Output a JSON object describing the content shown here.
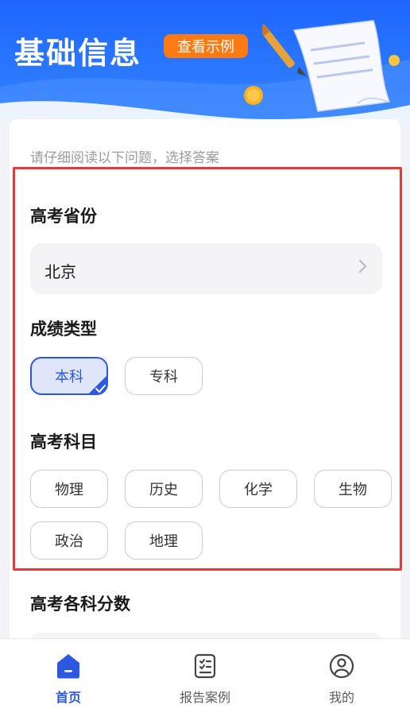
{
  "header": {
    "title": "基础信息",
    "example_button": "查看示例"
  },
  "hint": "请仔细阅读以下问题，选择答案",
  "province": {
    "label": "高考省份",
    "value": "北京"
  },
  "score_type": {
    "label": "成绩类型",
    "options": [
      "本科",
      "专科"
    ],
    "selected": "本科"
  },
  "subjects": {
    "label": "高考科目",
    "options": [
      "物理",
      "历史",
      "化学",
      "生物",
      "政治",
      "地理"
    ]
  },
  "scores": {
    "label": "高考各科分数"
  },
  "tabbar": {
    "items": [
      {
        "label": "首页",
        "icon": "home-icon",
        "active": true
      },
      {
        "label": "报告案例",
        "icon": "report-list-icon",
        "active": false
      },
      {
        "label": "我的",
        "icon": "profile-icon",
        "active": false
      }
    ]
  },
  "colors": {
    "primary": "#2c58e0",
    "header_blue": "#1e66ff",
    "accent_orange": "#ff7a12",
    "highlight_red": "#e23b3b"
  }
}
